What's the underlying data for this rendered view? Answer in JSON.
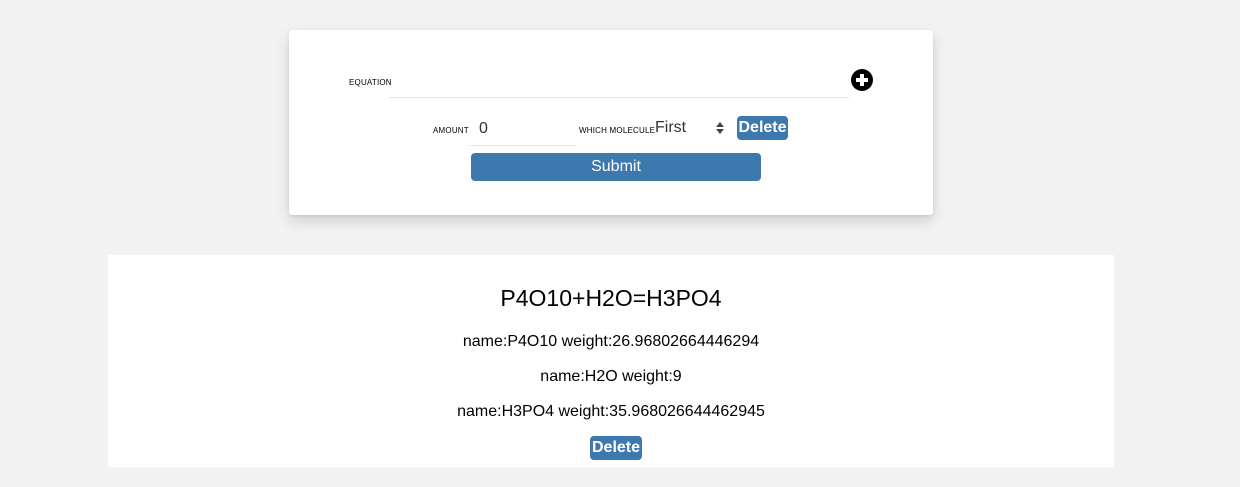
{
  "form": {
    "equation_label": "EQUATION",
    "equation_value": "",
    "add_icon": "plus-circle-icon",
    "amount_label": "AMOUNT",
    "amount_value": "0",
    "molecule_label": "WHICH MOLECULE",
    "molecule_selected": "First",
    "delete_label": "Delete",
    "submit_label": "Submit"
  },
  "result": {
    "equation": "P4O10+H2O=H3PO4",
    "molecules": [
      "name:P4O10 weight:26.96802664446294",
      "name:H2O weight:9",
      "name:H3PO4 weight:35.968026644462945"
    ],
    "delete_label": "Delete"
  },
  "colors": {
    "button": "#3d79ae",
    "page_background": "#f2f2f2",
    "card_background": "#ffffff"
  }
}
